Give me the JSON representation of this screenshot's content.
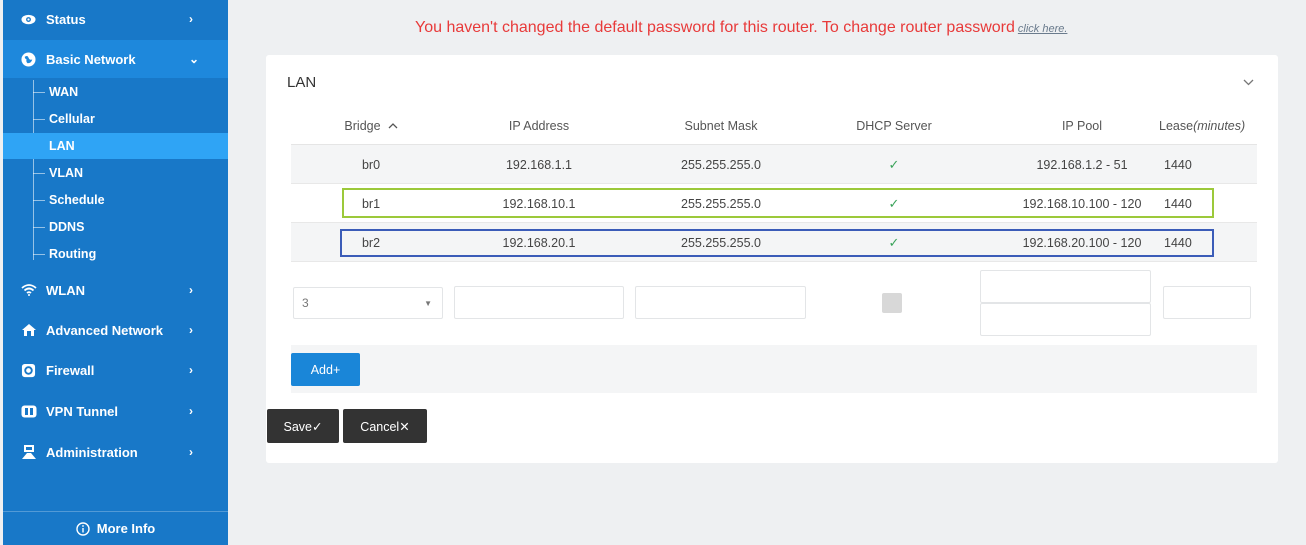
{
  "nav": {
    "status": "Status",
    "basic_network": "Basic Network",
    "sub": [
      "WAN",
      "Cellular",
      "LAN",
      "VLAN",
      "Schedule",
      "DDNS",
      "Routing"
    ],
    "wlan": "WLAN",
    "advanced_network": "Advanced Network",
    "firewall": "Firewall",
    "vpn_tunnel": "VPN Tunnel",
    "administration": "Administration",
    "more_info": "More Info"
  },
  "warning": {
    "text": "You haven't changed the default password for this router. To change router password",
    "link": "click here."
  },
  "card": {
    "title": "LAN",
    "columns": {
      "bridge": "Bridge",
      "ip": "IP Address",
      "mask": "Subnet Mask",
      "dhcp": "DHCP Server",
      "pool": "IP Pool",
      "lease_prefix": "Lease",
      "lease_unit": "(minutes)"
    },
    "rows": [
      {
        "bridge": "br0",
        "ip": "192.168.1.1",
        "mask": "255.255.255.0",
        "dhcp": "✓",
        "pool": "192.168.1.2 - 51",
        "lease": "1440"
      },
      {
        "bridge": "br1",
        "ip": "192.168.10.1",
        "mask": "255.255.255.0",
        "dhcp": "✓",
        "pool": "192.168.10.100 - 120",
        "lease": "1440"
      },
      {
        "bridge": "br2",
        "ip": "192.168.20.1",
        "mask": "255.255.255.0",
        "dhcp": "✓",
        "pool": "192.168.20.100 - 120",
        "lease": "1440"
      }
    ],
    "new_row": {
      "bridge_select": "3"
    },
    "add_label": "Add+",
    "save_label": "Save✓",
    "cancel_label": "Cancel✕"
  },
  "colors": {
    "sidebar": "#1878c8",
    "active_item": "#2fa4f5",
    "warning": "#e83a3a",
    "highlight_br1": "#9cc93a",
    "highlight_br2": "#3b5cb8",
    "primary_button": "#1a86d8"
  }
}
